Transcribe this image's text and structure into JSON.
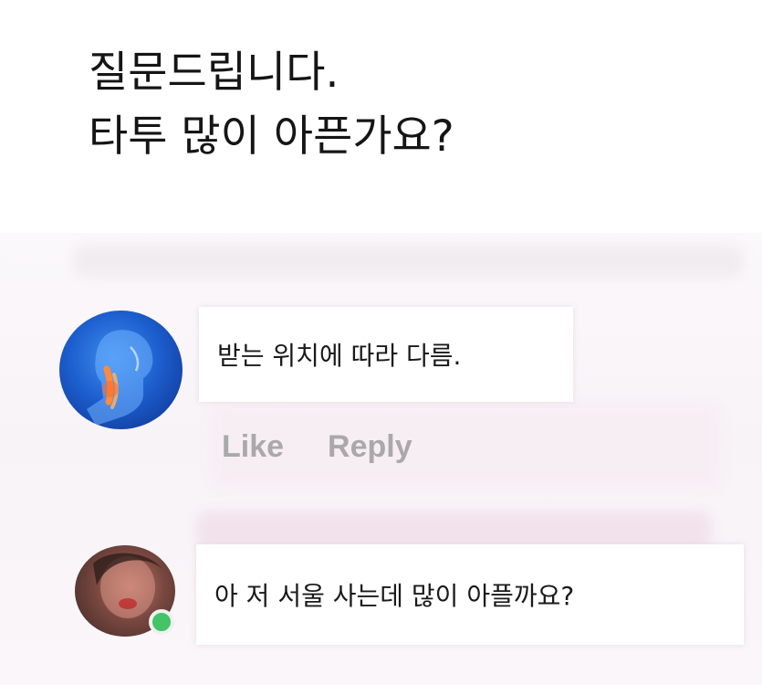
{
  "post": {
    "title_line1": "질문드립니다.",
    "title_line2": "타투 많이 아픈가요?"
  },
  "comments": [
    {
      "text": "받는 위치에 따라 다름.",
      "avatar_icon": "anatomy-throat-icon",
      "actions": {
        "like": "Like",
        "reply": "Reply"
      }
    },
    {
      "text": "아 저 서울 사는데 많이 아플까요?",
      "avatar_icon": "user-photo-icon",
      "online": true
    }
  ],
  "colors": {
    "action_text": "#a9a9a9",
    "online_dot": "#43c467",
    "avatar1_accent": "#1d5fcf"
  }
}
